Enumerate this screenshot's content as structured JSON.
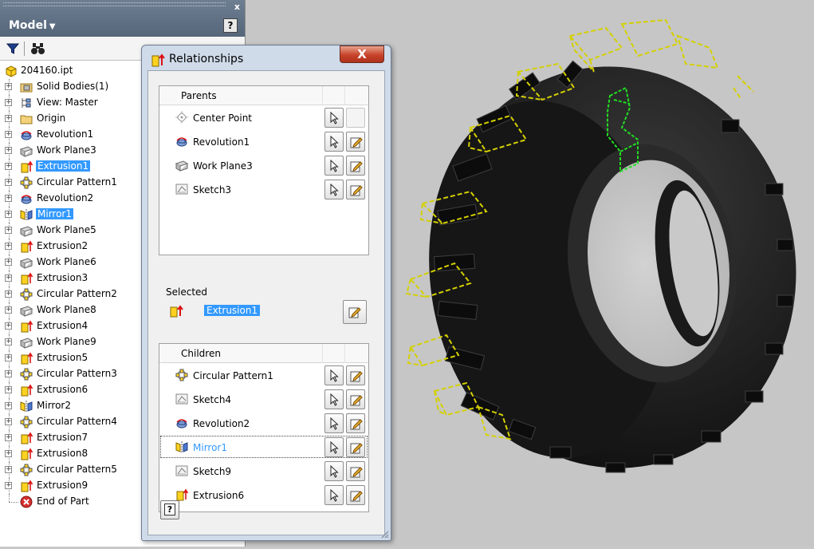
{
  "browser": {
    "title": "Model",
    "close_glyph": "x",
    "help_glyph": "?",
    "root": "204160.ipt",
    "items": [
      {
        "label": "Solid Bodies(1)",
        "icon": "folder-bodies-icon",
        "expander": true
      },
      {
        "label": "View: Master",
        "icon": "view-icon",
        "expander": true
      },
      {
        "label": "Origin",
        "icon": "folder-icon",
        "expander": true
      },
      {
        "label": "Revolution1",
        "icon": "revolve-icon",
        "expander": true
      },
      {
        "label": "Work Plane3",
        "icon": "work-plane-icon",
        "expander": true
      },
      {
        "label": "Extrusion1",
        "icon": "extrude-icon",
        "expander": true,
        "selected": true
      },
      {
        "label": "Circular Pattern1",
        "icon": "circular-pattern-icon",
        "expander": true
      },
      {
        "label": "Revolution2",
        "icon": "revolve-icon",
        "expander": true
      },
      {
        "label": "Mirror1",
        "icon": "mirror-icon",
        "expander": true,
        "selected": true
      },
      {
        "label": "Work Plane5",
        "icon": "work-plane-icon",
        "expander": true
      },
      {
        "label": "Extrusion2",
        "icon": "extrude-icon",
        "expander": true
      },
      {
        "label": "Work Plane6",
        "icon": "work-plane-icon",
        "expander": true
      },
      {
        "label": "Extrusion3",
        "icon": "extrude-icon",
        "expander": true
      },
      {
        "label": "Circular Pattern2",
        "icon": "circular-pattern-icon",
        "expander": true
      },
      {
        "label": "Work Plane8",
        "icon": "work-plane-icon",
        "expander": true
      },
      {
        "label": "Extrusion4",
        "icon": "extrude-icon",
        "expander": true
      },
      {
        "label": "Work Plane9",
        "icon": "work-plane-icon",
        "expander": true
      },
      {
        "label": "Extrusion5",
        "icon": "extrude-icon",
        "expander": true
      },
      {
        "label": "Circular Pattern3",
        "icon": "circular-pattern-icon",
        "expander": true
      },
      {
        "label": "Extrusion6",
        "icon": "extrude-icon",
        "expander": true
      },
      {
        "label": "Mirror2",
        "icon": "mirror-icon",
        "expander": true
      },
      {
        "label": "Circular Pattern4",
        "icon": "circular-pattern-icon",
        "expander": true
      },
      {
        "label": "Extrusion7",
        "icon": "extrude-icon",
        "expander": true
      },
      {
        "label": "Extrusion8",
        "icon": "extrude-icon",
        "expander": true
      },
      {
        "label": "Circular Pattern5",
        "icon": "circular-pattern-icon",
        "expander": true
      },
      {
        "label": "Extrusion9",
        "icon": "extrude-icon",
        "expander": true
      },
      {
        "label": "End of Part",
        "icon": "end-of-part-icon",
        "expander": false
      }
    ]
  },
  "dialog": {
    "title": "Relationships",
    "close_glyph": "X",
    "parents": {
      "header": "Parents",
      "items": [
        {
          "label": "Center Point",
          "icon": "center-point-icon",
          "edit_enabled": false
        },
        {
          "label": "Revolution1",
          "icon": "revolve-icon",
          "edit_enabled": true
        },
        {
          "label": "Work Plane3",
          "icon": "work-plane-icon",
          "edit_enabled": true
        },
        {
          "label": "Sketch3",
          "icon": "sketch-icon",
          "edit_enabled": true
        }
      ]
    },
    "selected": {
      "label": "Selected",
      "item": "Extrusion1"
    },
    "children": {
      "header": "Children",
      "items": [
        {
          "label": "Circular Pattern1",
          "icon": "circular-pattern-icon"
        },
        {
          "label": "Sketch4",
          "icon": "sketch-icon"
        },
        {
          "label": "Revolution2",
          "icon": "revolve-icon"
        },
        {
          "label": "Mirror1",
          "icon": "mirror-icon",
          "highlight": true
        },
        {
          "label": "Sketch9",
          "icon": "sketch-icon"
        },
        {
          "label": "Extrusion6",
          "icon": "extrude-icon"
        }
      ]
    },
    "help_glyph": "?"
  },
  "colors": {
    "selection": "#3399ff",
    "preview_yellow": "#d4d000",
    "preview_green": "#22dd22",
    "viewport_bg": "#c6c6c6",
    "tire": "#1e1e1e"
  }
}
